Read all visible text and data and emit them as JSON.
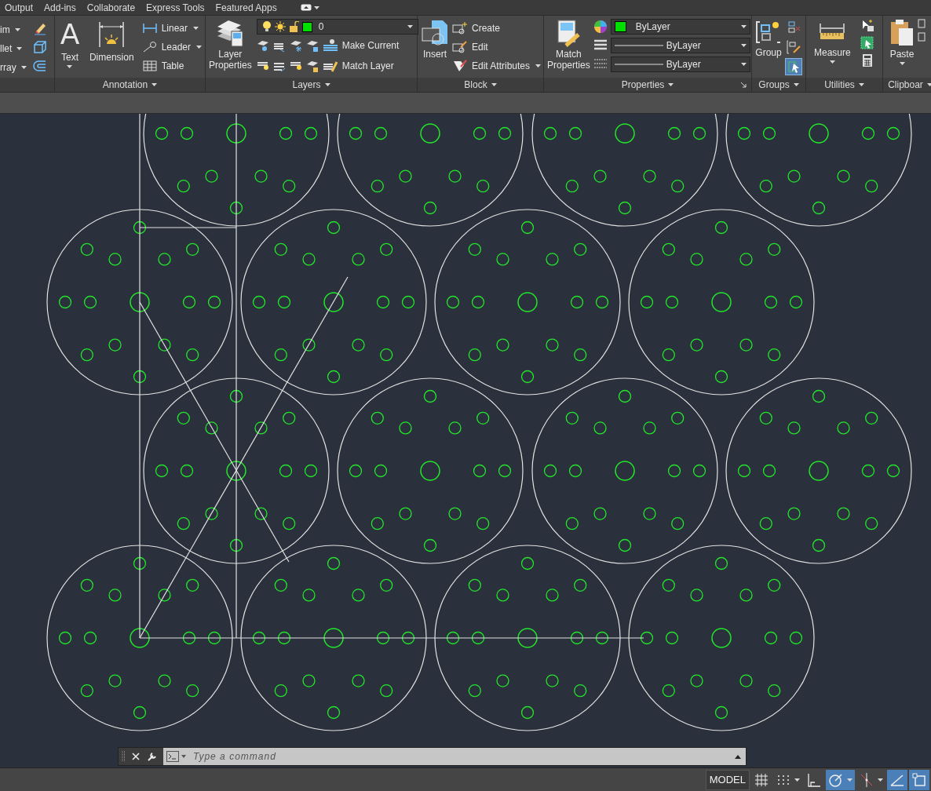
{
  "ribbon_tabs": [
    "Output",
    "Add-ins",
    "Collaborate",
    "Express Tools",
    "Featured Apps"
  ],
  "modify_panel": {
    "items": [
      "im",
      "llet",
      "rray"
    ]
  },
  "annotation_panel": {
    "title": "Annotation",
    "text_icon": "A",
    "big_buttons": [
      "Text",
      "Dimension"
    ],
    "small_buttons": [
      {
        "label": "Linear",
        "dropdown": true
      },
      {
        "label": "Leader",
        "dropdown": true
      },
      {
        "label": "Table",
        "dropdown": false
      }
    ]
  },
  "layers_panel": {
    "title": "Layers",
    "big_button": "Layer Properties",
    "current_layer": "0",
    "small_buttons": [
      "Make Current",
      "Match Layer"
    ]
  },
  "block_panel": {
    "title": "Block",
    "big_button": "Insert",
    "small_buttons": [
      {
        "label": "Create",
        "dropdown": false
      },
      {
        "label": "Edit",
        "dropdown": false
      },
      {
        "label": "Edit Attributes",
        "dropdown": true
      }
    ]
  },
  "properties_panel": {
    "title": "Properties",
    "big_button": "Match Properties",
    "dropdowns": [
      {
        "kind": "color",
        "value": "ByLayer"
      },
      {
        "kind": "lineweight",
        "value": "ByLayer"
      },
      {
        "kind": "linetype",
        "value": "ByLayer"
      }
    ]
  },
  "groups_panel": {
    "title": "Groups",
    "big_button": "Group",
    "tools": [
      {
        "kind": "ungroup",
        "on": false
      },
      {
        "kind": "edit",
        "on": false
      },
      {
        "kind": "select",
        "on": true
      }
    ]
  },
  "utilities_panel": {
    "title": "Utilities",
    "big_button": "Measure"
  },
  "clipboard_panel": {
    "title": "Clipboar",
    "big_button": "Paste"
  },
  "command_line": {
    "placeholder": "Type a command"
  },
  "status_bar": {
    "space": "MODEL",
    "toggles": [
      {
        "kind": "grid",
        "on": false,
        "dropdown": false
      },
      {
        "kind": "snap",
        "on": false,
        "dropdown": true
      },
      {
        "kind": "ortho",
        "on": false,
        "dropdown": false
      },
      {
        "kind": "polar",
        "on": true,
        "dropdown": true
      },
      {
        "kind": "tracking",
        "on": false,
        "dropdown": true
      },
      {
        "kind": "angle",
        "on": true,
        "dropdown": false
      },
      {
        "kind": "ucs",
        "on": true,
        "dropdown": false
      }
    ]
  }
}
